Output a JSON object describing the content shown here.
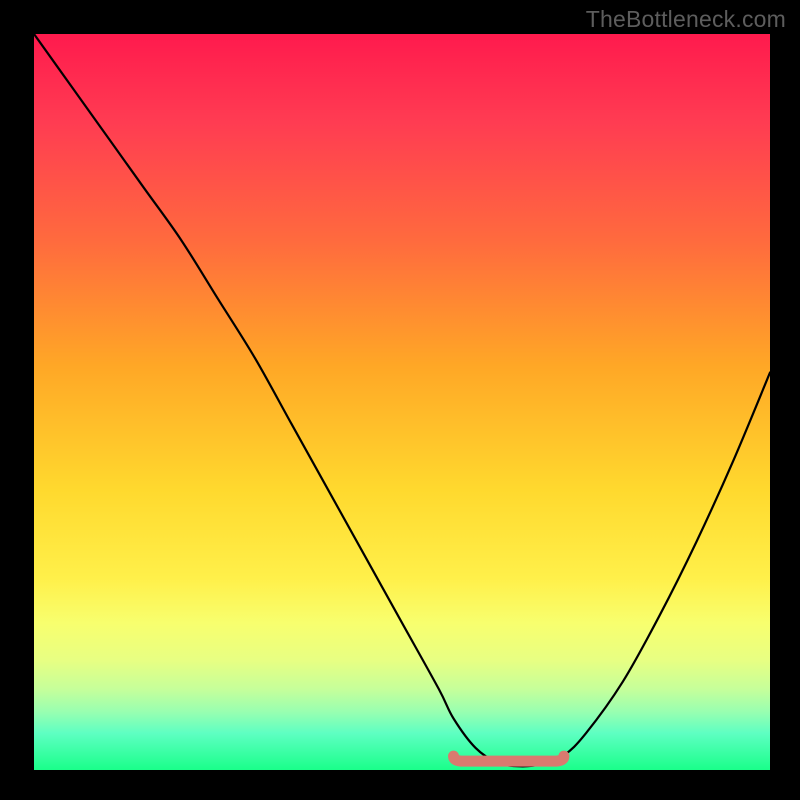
{
  "watermark": "TheBottleneck.com",
  "chart_data": {
    "type": "line",
    "title": "",
    "xlabel": "",
    "ylabel": "",
    "xlim": [
      0,
      100
    ],
    "ylim": [
      0,
      100
    ],
    "series": [
      {
        "name": "bottleneck-curve",
        "x": [
          0,
          5,
          10,
          15,
          20,
          25,
          30,
          35,
          40,
          45,
          50,
          55,
          57,
          60,
          63,
          66,
          69,
          72,
          75,
          80,
          85,
          90,
          95,
          100
        ],
        "y": [
          100,
          93,
          86,
          79,
          72,
          64,
          56,
          47,
          38,
          29,
          20,
          11,
          7,
          3,
          1,
          0.5,
          0.8,
          2,
          5,
          12,
          21,
          31,
          42,
          54
        ]
      }
    ],
    "marker": {
      "name": "optimal-range",
      "color": "#d97a6f",
      "x_start": 57,
      "x_end": 72,
      "y": 1.2
    },
    "background_gradient": {
      "top": "#ff1a4d",
      "mid": "#ffd92e",
      "bottom": "#1aff8a"
    }
  }
}
